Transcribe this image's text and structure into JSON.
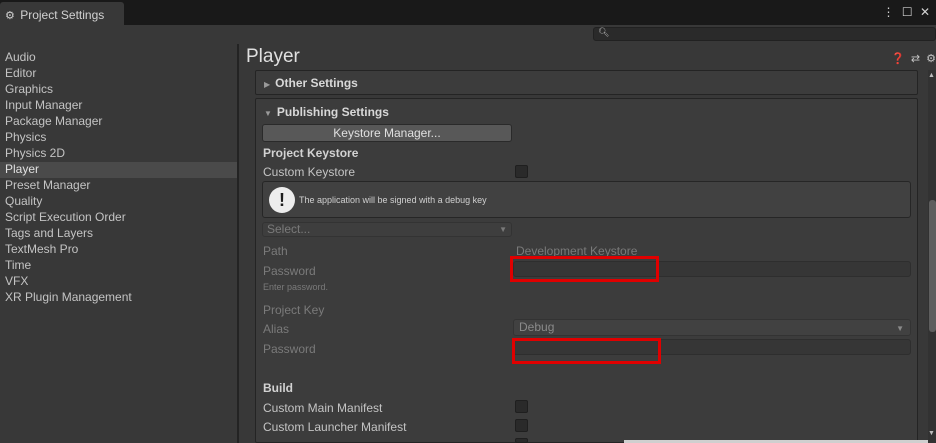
{
  "window": {
    "tab_title": "Project Settings",
    "tab_icon": "gear-icon",
    "controls": "⋮ ☐ ✕"
  },
  "search": {
    "placeholder": ""
  },
  "sidebar": {
    "items": [
      {
        "label": "Audio"
      },
      {
        "label": "Editor"
      },
      {
        "label": "Graphics"
      },
      {
        "label": "Input Manager"
      },
      {
        "label": "Package Manager"
      },
      {
        "label": "Physics"
      },
      {
        "label": "Physics 2D"
      },
      {
        "label": "Player",
        "selected": true
      },
      {
        "label": "Preset Manager"
      },
      {
        "label": "Quality"
      },
      {
        "label": "Script Execution Order"
      },
      {
        "label": "Tags and Layers"
      },
      {
        "label": "TextMesh Pro"
      },
      {
        "label": "Time"
      },
      {
        "label": "VFX"
      },
      {
        "label": "XR Plugin Management"
      }
    ]
  },
  "main": {
    "title": "Player",
    "header_icons": "❓ ⇄ ⚙",
    "other_settings": "Other Settings",
    "publishing_settings": "Publishing Settings",
    "keystore_manager_button": "Keystore Manager...",
    "project_keystore_heading": "Project Keystore",
    "custom_keystore_label": "Custom Keystore",
    "help_text": "The application will be signed with a debug key",
    "select_value": "Select...",
    "path_label": "Path",
    "path_value": "Development Keystore",
    "password_label": "Password",
    "password_hint": "Enter password.",
    "project_key_heading": "Project Key",
    "alias_label": "Alias",
    "alias_value": "Debug",
    "key_password_label": "Password",
    "build_heading": "Build",
    "custom_main_manifest": "Custom Main Manifest",
    "custom_launcher_manifest": "Custom Launcher Manifest"
  },
  "colors": {
    "background": "#383838",
    "titlebar": "#191919",
    "highlight_box": "#e00000",
    "selected_item": "#4a4a4a"
  }
}
